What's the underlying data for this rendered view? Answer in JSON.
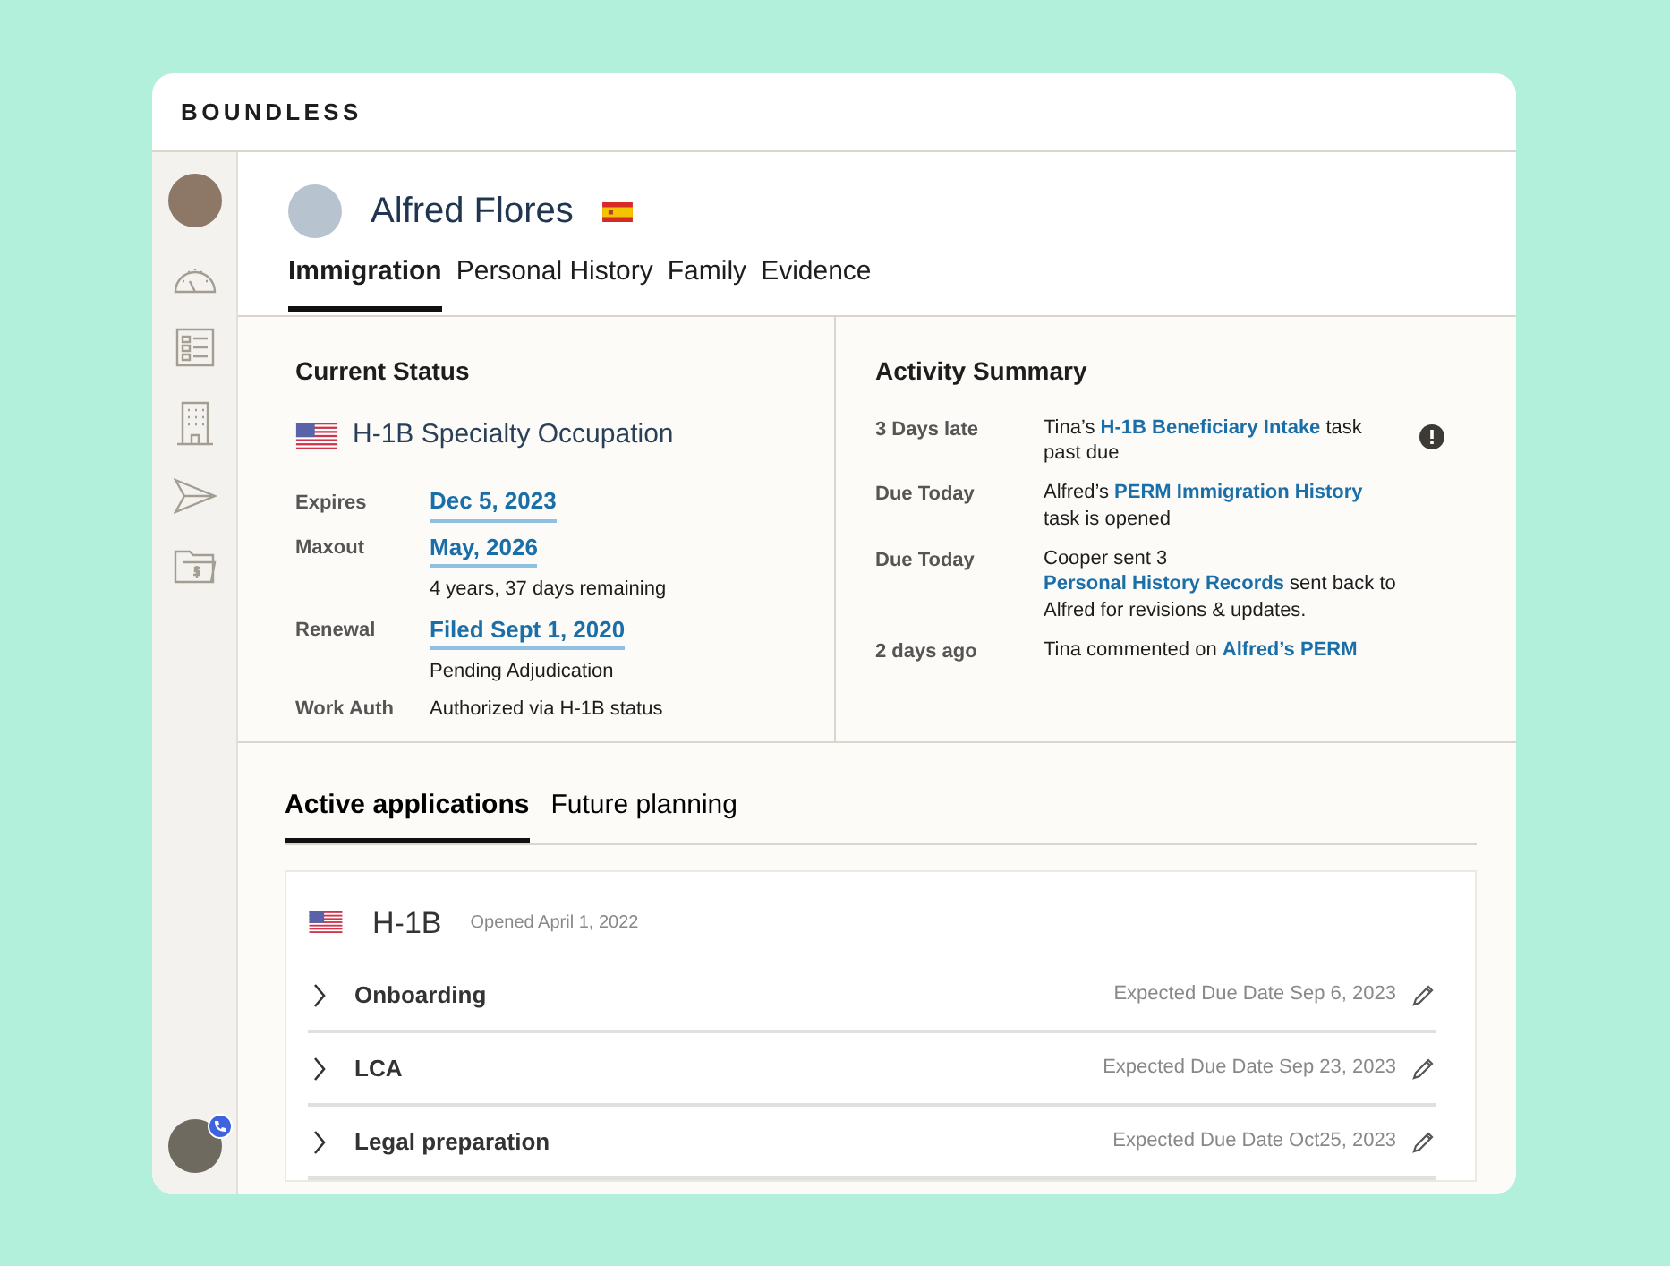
{
  "brand": "BOUNDLESS",
  "sidebar": {
    "items": [
      {
        "kind": "avatar"
      },
      {
        "kind": "gauge"
      },
      {
        "kind": "checklist"
      },
      {
        "kind": "building"
      },
      {
        "kind": "send"
      },
      {
        "kind": "folder"
      }
    ],
    "footer_avatar": {
      "badge": true
    }
  },
  "profile": {
    "name": "Alfred Flores"
  },
  "tabs": [
    {
      "label": "Immigration",
      "selected": true
    },
    {
      "label": "Personal History",
      "selected": false
    },
    {
      "label": "Family",
      "selected": false
    },
    {
      "label": "Evidence",
      "selected": false
    }
  ],
  "current_status": {
    "title": "Current Status",
    "visa": "H-1B Specialty Occupation",
    "fields": [
      {
        "label": "Expires",
        "value": "Dec 5, 2023",
        "link": true
      },
      {
        "label": "Maxout",
        "value": "May, 2026",
        "link": true,
        "note": "4 years, 37 days remaining"
      },
      {
        "label": "Renewal",
        "value": "Filed Sept 1, 2020",
        "link": true,
        "note": "Pending Adjudication"
      },
      {
        "label": "Work Auth",
        "value": "Authorized via H-1B status",
        "link": false
      }
    ]
  },
  "activity": {
    "title": "Activity Summary",
    "items": [
      {
        "when": "3 Days late",
        "alert": true,
        "parts": [
          {
            "text": "Tina’s ",
            "link": false
          },
          {
            "text": "H-1B Beneficiary Intake",
            "link": true
          },
          {
            "text": " task past due",
            "link": false
          }
        ]
      },
      {
        "when": "Due Today",
        "alert": false,
        "parts": [
          {
            "text": "Alfred’s ",
            "link": false
          },
          {
            "text": "PERM Immigration History",
            "link": true
          },
          {
            "text": " task is opened",
            "link": false
          }
        ]
      },
      {
        "when": "Due Today",
        "alert": false,
        "parts": [
          {
            "text": "Cooper sent 3 ",
            "link": false
          },
          {
            "text": "Personal History Records",
            "link": true
          },
          {
            "text": " sent back to Alfred for revisions & updates.",
            "link": false
          }
        ]
      },
      {
        "when": "2 days ago",
        "alert": false,
        "parts": [
          {
            "text": "Tina commented on ",
            "link": false
          },
          {
            "text": "Alfred’s PERM",
            "link": true
          }
        ]
      }
    ]
  },
  "app_tabs": [
    {
      "label": "Active applications",
      "selected": true
    },
    {
      "label": "Future planning",
      "selected": false
    }
  ],
  "application": {
    "title": "H-1B",
    "opened": "Opened April 1, 2022",
    "steps": [
      {
        "title": "Onboarding",
        "due": "Expected Due Date Sep 6, 2023",
        "expanded": false
      },
      {
        "title": "LCA",
        "due": "Expected Due Date Sep 23, 2023",
        "expanded": false
      },
      {
        "title": "Legal preparation",
        "due": "Expected Due Date Oct25, 2023",
        "expanded": false
      }
    ]
  }
}
